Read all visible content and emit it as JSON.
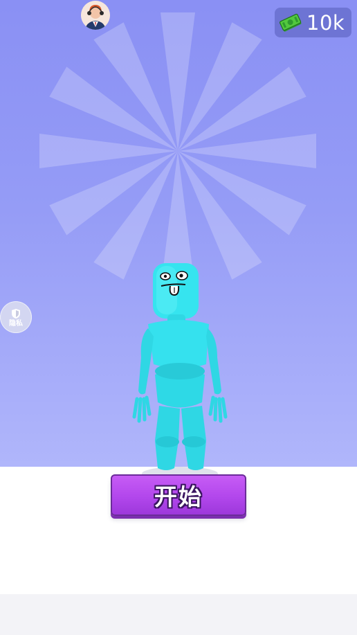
{
  "currency": {
    "value": "10k",
    "icon": "cash-icon"
  },
  "privacy": {
    "label": "隐私",
    "icon": "shield-icon"
  },
  "avatar": {
    "icon": "player-avatar-icon"
  },
  "start_button": {
    "label": "开始"
  },
  "character": {
    "name": "cyan-stickman-character"
  },
  "colors": {
    "sky_top": "#8a90f4",
    "sky_bottom": "#b0b6fb",
    "character": "#2ee6f2",
    "start_button": "#b247ec",
    "floor": "#ffffff"
  }
}
